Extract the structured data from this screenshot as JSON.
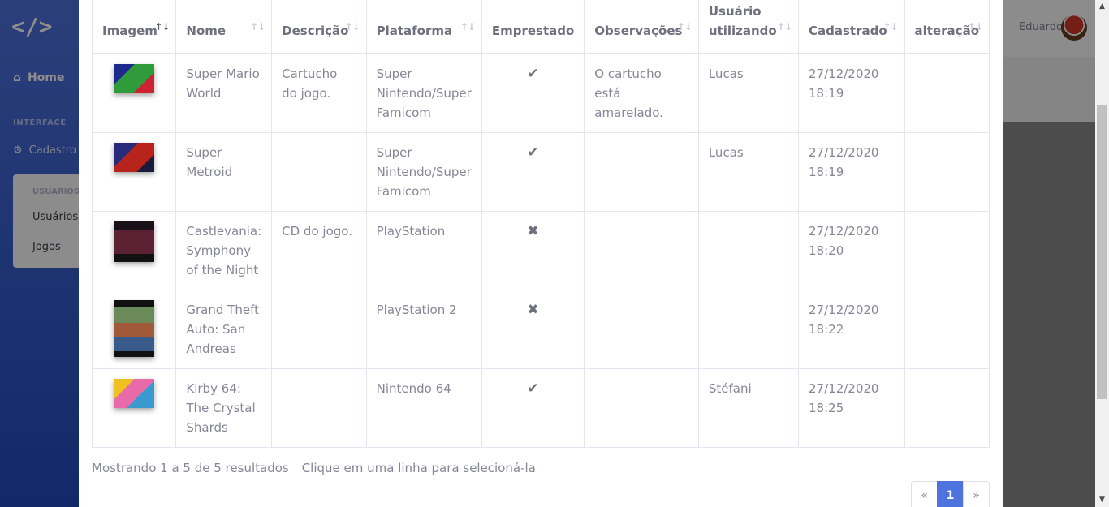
{
  "app": {
    "brand": "</>",
    "nav_home": "Home",
    "nav_heading": "INTERFACE",
    "nav_cadastro": "Cadastro",
    "subpanel_heading": "USUÁRIOS",
    "subpanel_items": [
      "Usuários",
      "Jogos"
    ],
    "user_name": "Eduardo"
  },
  "table": {
    "columns": [
      "Imagem",
      "Nome",
      "Descrição",
      "Plataforma",
      "Emprestado",
      "Observações",
      "Usuário utilizando",
      "Cadastrado",
      "alteração"
    ],
    "rows": [
      {
        "nome": "Super Mario World",
        "descricao": "Cartucho do jogo.",
        "plataforma": "Super Nintendo/Super Famicom",
        "emprestado": "✔",
        "observacoes": "O cartucho está amarelado.",
        "usuario": "Lucas",
        "cadastrado": "27/12/2020 18:19",
        "alteracao": ""
      },
      {
        "nome": "Super Metroid",
        "descricao": "",
        "plataforma": "Super Nintendo/Super Famicom",
        "emprestado": "✔",
        "observacoes": "",
        "usuario": "Lucas",
        "cadastrado": "27/12/2020 18:19",
        "alteracao": ""
      },
      {
        "nome": "Castlevania: Symphony of the Night",
        "descricao": "CD do jogo.",
        "plataforma": "PlayStation",
        "emprestado": "✖",
        "observacoes": "",
        "usuario": "",
        "cadastrado": "27/12/2020 18:20",
        "alteracao": ""
      },
      {
        "nome": "Grand Theft Auto: San Andreas",
        "descricao": "",
        "plataforma": "PlayStation 2",
        "emprestado": "✖",
        "observacoes": "",
        "usuario": "",
        "cadastrado": "27/12/2020 18:22",
        "alteracao": ""
      },
      {
        "nome": "Kirby 64: The Crystal Shards",
        "descricao": "",
        "plataforma": "Nintendo 64",
        "emprestado": "✔",
        "observacoes": "",
        "usuario": "Stéfani",
        "cadastrado": "27/12/2020 18:25",
        "alteracao": ""
      }
    ]
  },
  "footer": {
    "info": "Mostrando 1 a 5 de 5 resultados",
    "hint": "Clique em uma linha para selecioná-la"
  },
  "pagination": {
    "prev": "«",
    "current": "1",
    "next": "»"
  },
  "colors": {
    "primary": "#4e73df",
    "text": "#858796",
    "border": "#e3e6f0"
  }
}
